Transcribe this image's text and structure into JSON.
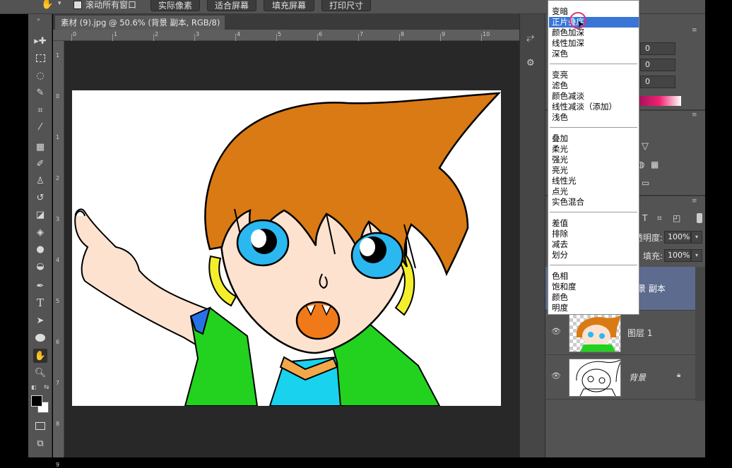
{
  "options_bar": {
    "scroll_all_label": "滚动所有窗口",
    "btn_actual_pixels": "实际像素",
    "btn_fit_screen": "适合屏幕",
    "btn_fill_screen": "填充屏幕",
    "btn_print_size": "打印尺寸"
  },
  "document": {
    "tab_title": "素材 (9).jpg @ 50.6% (背景 副本, RGB/8) *",
    "tab_close": "×"
  },
  "ruler": {
    "top_ticks": [
      "0",
      "1",
      "2",
      "3",
      "4",
      "5",
      "6",
      "7",
      "8",
      "9",
      "10"
    ],
    "left_ticks": [
      "1",
      "0",
      "1",
      "2",
      "3",
      "4",
      "5",
      "6",
      "7",
      "8",
      "9"
    ]
  },
  "color_panel": {
    "r": "0",
    "g": "0",
    "b": "0"
  },
  "layers_panel": {
    "opacity_label": "不透明度:",
    "opacity_value": "100%",
    "fill_label": "填充:",
    "fill_value": "100%",
    "layers": [
      {
        "name": "背景 副本",
        "selected": true
      },
      {
        "name": "图层 1",
        "selected": false
      },
      {
        "name": "背景",
        "selected": false,
        "locked": true
      }
    ]
  },
  "blend_menu": {
    "groups": [
      [
        "变暗",
        "正片叠底",
        "颜色加深",
        "线性加深",
        "深色"
      ],
      [
        "变亮",
        "滤色",
        "颜色减淡",
        "线性减淡（添加）",
        "浅色"
      ],
      [
        "叠加",
        "柔光",
        "强光",
        "亮光",
        "线性光",
        "点光",
        "实色混合"
      ],
      [
        "差值",
        "排除",
        "减去",
        "划分"
      ],
      [
        "色相",
        "饱和度",
        "颜色",
        "明度"
      ]
    ],
    "selected": "正片叠底"
  },
  "colors": {
    "menu_highlight": "#3875d7",
    "hair": "#d97a14",
    "eye": "#2bb8f0",
    "jacket": "#22d21f",
    "shirt": "#19d2ee",
    "skin": "#fde2cf",
    "mouth": "#f07a1a"
  }
}
